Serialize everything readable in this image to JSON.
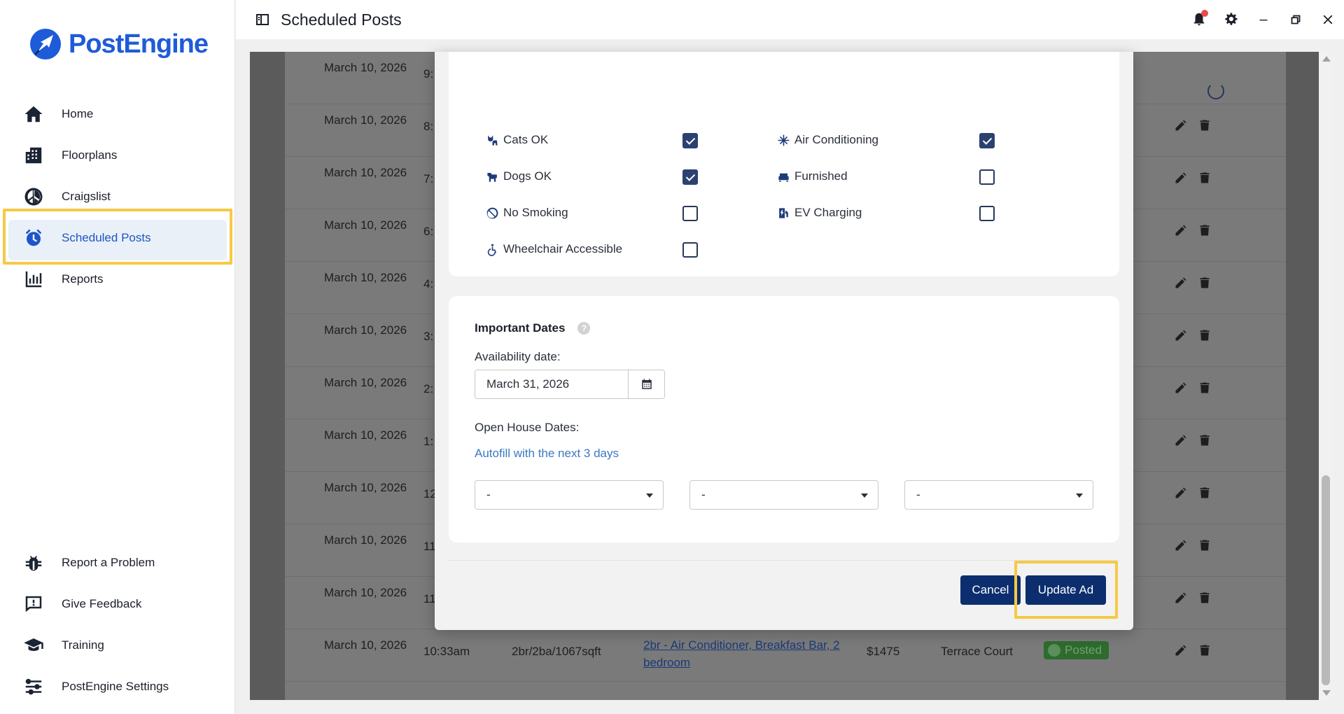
{
  "app": {
    "name": "PostEngine",
    "header_title": "Scheduled Posts"
  },
  "colors": {
    "brand": "#1e5bd8",
    "primary_button": "#0d2e6e",
    "highlight": "#f6c945",
    "link": "#3a78c3"
  },
  "sidebar": {
    "top_items": [
      {
        "label": "Home",
        "icon": "home-icon"
      },
      {
        "label": "Floorplans",
        "icon": "building-icon"
      },
      {
        "label": "Craigslist",
        "icon": "peace-icon"
      },
      {
        "label": "Scheduled Posts",
        "icon": "alarm-clock-icon",
        "active": true
      },
      {
        "label": "Reports",
        "icon": "bar-chart-icon"
      }
    ],
    "bottom_items": [
      {
        "label": "Report a Problem",
        "icon": "bug-icon"
      },
      {
        "label": "Give Feedback",
        "icon": "feedback-icon"
      },
      {
        "label": "Training",
        "icon": "graduation-cap-icon"
      },
      {
        "label": "PostEngine Settings",
        "icon": "sliders-icon"
      }
    ]
  },
  "table": {
    "rows": [
      {
        "date": "March 10, 2026",
        "time": "9:",
        "loading": true
      },
      {
        "date": "March 10, 2026",
        "time": "8:"
      },
      {
        "date": "March 10, 2026",
        "time": "7:"
      },
      {
        "date": "March 10, 2026",
        "time": "6:"
      },
      {
        "date": "March 10, 2026",
        "time": "4:"
      },
      {
        "date": "March 10, 2026",
        "time": "3:"
      },
      {
        "date": "March 10, 2026",
        "time": "2:"
      },
      {
        "date": "March 10, 2026",
        "time": "1:"
      },
      {
        "date": "March 10, 2026",
        "time": "12"
      },
      {
        "date": "March 10, 2026",
        "time": "11"
      },
      {
        "date": "March 10, 2026",
        "time": "11"
      },
      {
        "date": "March 10, 2026",
        "time": "10:33am",
        "plan": "2br/2ba/1067sqft",
        "title": "2br - Air Conditioner, Breakfast Bar, 2 bedroom",
        "price": "$1475",
        "property": "Terrace Court",
        "status": "Posted"
      }
    ]
  },
  "modal": {
    "amenities_left": [
      {
        "label": "Cats OK",
        "icon": "cat-icon",
        "checked": true
      },
      {
        "label": "Dogs OK",
        "icon": "dog-icon",
        "checked": true
      },
      {
        "label": "No Smoking",
        "icon": "no-smoking-icon",
        "checked": false
      },
      {
        "label": "Wheelchair Accessible",
        "icon": "wheelchair-icon",
        "checked": false
      }
    ],
    "amenities_right": [
      {
        "label": "Air Conditioning",
        "icon": "snowflake-icon",
        "checked": true
      },
      {
        "label": "Furnished",
        "icon": "couch-icon",
        "checked": false
      },
      {
        "label": "EV Charging",
        "icon": "ev-charging-icon",
        "checked": false
      }
    ],
    "important_dates": {
      "title": "Important Dates",
      "help": "?",
      "availability_label": "Availability date:",
      "availability_value": "March 31, 2026",
      "open_house_label": "Open House Dates:",
      "autofill_link": "Autofill with the next 3 days",
      "open_house_selects": [
        "-",
        "-",
        "-"
      ]
    },
    "buttons": {
      "cancel": "Cancel",
      "update": "Update Ad"
    }
  }
}
